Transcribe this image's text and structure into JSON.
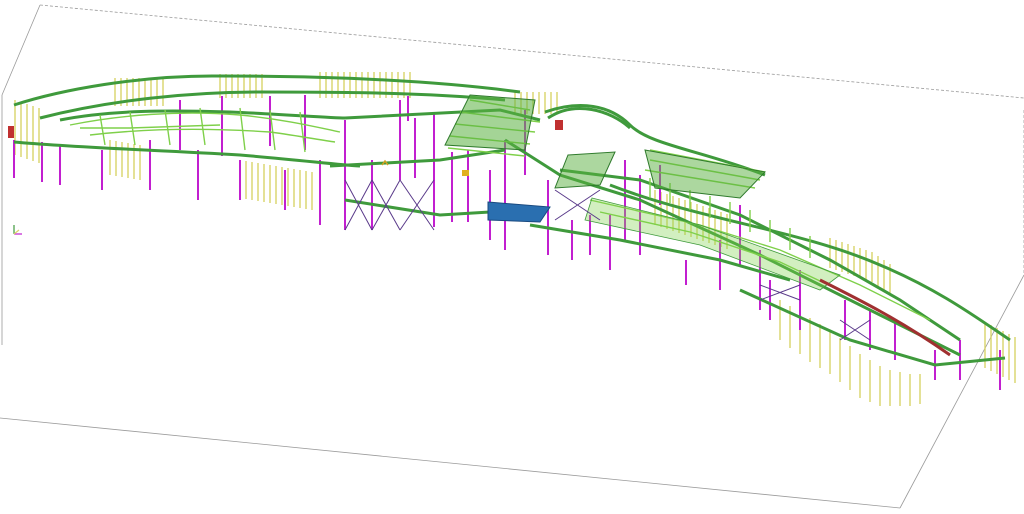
{
  "viewport": {
    "background": "#ffffff",
    "colors": {
      "beam": "#3f9a3c",
      "beam_light": "#7fd04a",
      "column": "#c21fd0",
      "railing": "#d8d46a",
      "brace": "#5a3a8a",
      "bounding_box": "#9a9a9a",
      "deck_blue": "#2a6fb0",
      "red_member": "#a03030"
    },
    "coordinate_indicator_icon": "axis-triad-icon"
  }
}
